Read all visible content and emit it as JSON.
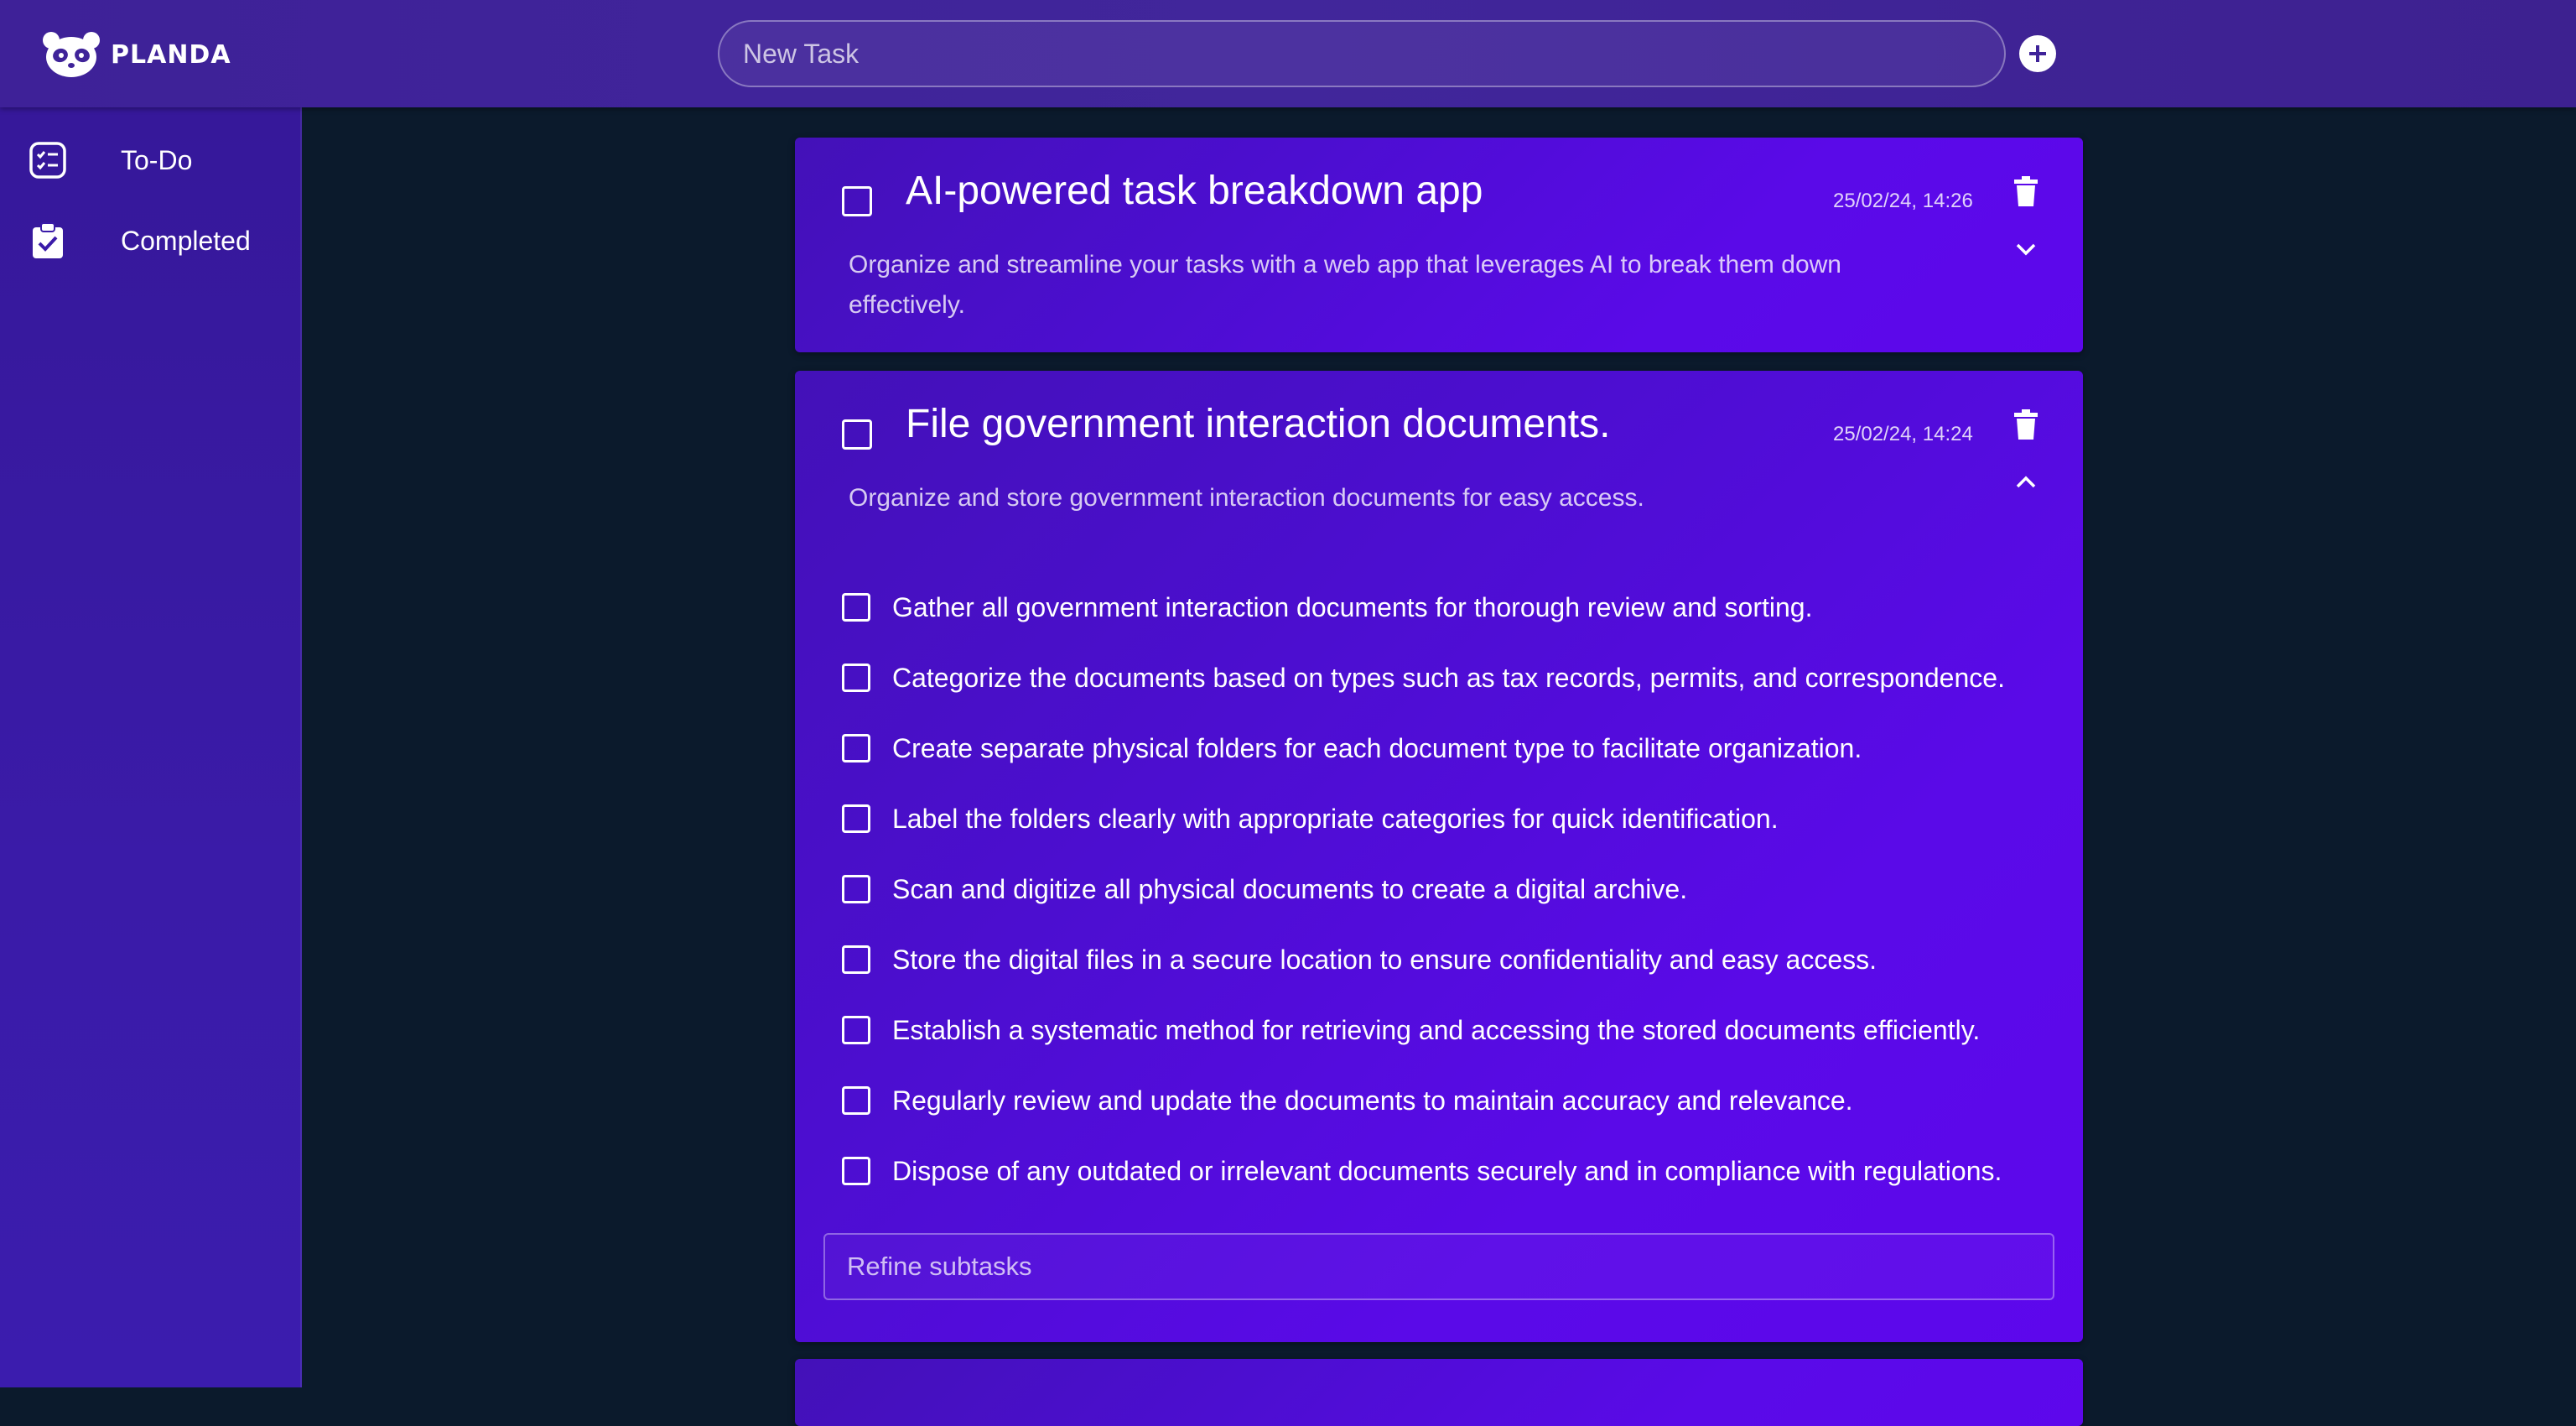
{
  "app": {
    "name": "PLANDA"
  },
  "header": {
    "new_task_placeholder": "New Task"
  },
  "sidebar": {
    "items": [
      {
        "label": "To-Do",
        "icon": "checklist-icon"
      },
      {
        "label": "Completed",
        "icon": "clipboard-check-icon"
      }
    ]
  },
  "tasks": [
    {
      "title": "AI-powered task breakdown app",
      "timestamp": "25/02/24, 14:26",
      "description": "Organize and streamline your tasks with a web app that leverages AI to break them down effectively.",
      "expanded": false
    },
    {
      "title": "File government interaction documents.",
      "timestamp": "25/02/24, 14:24",
      "description": "Organize and store government interaction documents for easy access.",
      "expanded": true,
      "subtasks": [
        "Gather all government interaction documents for thorough review and sorting.",
        "Categorize the documents based on types such as tax records, permits, and correspondence.",
        "Create separate physical folders for each document type to facilitate organization.",
        "Label the folders clearly with appropriate categories for quick identification.",
        "Scan and digitize all physical documents to create a digital archive.",
        "Store the digital files in a secure location to ensure confidentiality and easy access.",
        "Establish a systematic method for retrieving and accessing the stored documents efficiently.",
        "Regularly review and update the documents to maintain accuracy and relevance.",
        "Dispose of any outdated or irrelevant documents securely and in compliance with regulations."
      ],
      "refine_placeholder": "Refine subtasks"
    }
  ],
  "colors": {
    "page_background": "#0b1a2c",
    "topbar": "#3f2399",
    "sidebar": "#3a1ba8",
    "card_gradient_start": "#4311b8",
    "card_gradient_end": "#5d07ec"
  }
}
